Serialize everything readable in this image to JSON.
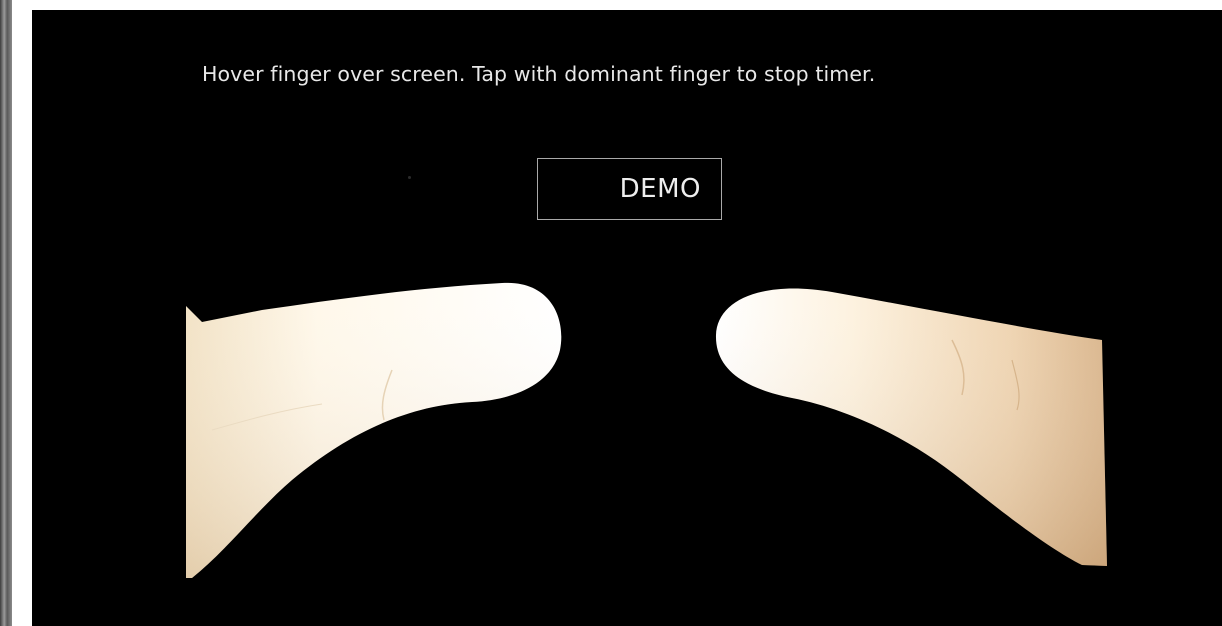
{
  "screen": {
    "instruction_text": "Hover finger over screen. Tap with dominant finger to stop timer.",
    "demo_button_label": "DEMO"
  },
  "colors": {
    "screen_background": "#000000",
    "instruction_text": "#e8e8e8",
    "demo_border": "#a9a9a9",
    "finger_highlight": "#fffaf0",
    "finger_skin": "#e9c9a4"
  },
  "scene": {
    "left_finger": "left-index-finger",
    "right_finger": "right-index-finger"
  }
}
